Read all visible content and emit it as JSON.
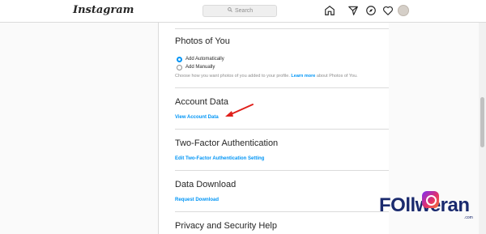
{
  "header": {
    "logo": "Instagram",
    "search_placeholder": "Search",
    "icons": [
      "home-icon",
      "direct-icon",
      "explore-icon",
      "activity-heart-icon",
      "profile-avatar"
    ]
  },
  "sections": {
    "photos_of_you": {
      "title": "Photos of You",
      "options": [
        "Add Automatically",
        "Add Manually"
      ],
      "selected": "Add Automatically",
      "help_before": "Choose how you want photos of you added to your profile.",
      "help_link": "Learn more",
      "help_after": "about Photos of You."
    },
    "account_data": {
      "title": "Account Data",
      "link": "View Account Data"
    },
    "two_factor": {
      "title": "Two-Factor Authentication",
      "link": "Edit Two-Factor Authentication Setting"
    },
    "data_download": {
      "title": "Data Download",
      "link": "Request Download"
    },
    "privacy_help": {
      "title": "Privacy and Security Help"
    }
  },
  "watermark": {
    "text": "FOllweran",
    "suffix": ".com"
  },
  "colors": {
    "link": "#0095f6",
    "annotation": "#e0201b",
    "watermark": "#1a2a6e"
  }
}
